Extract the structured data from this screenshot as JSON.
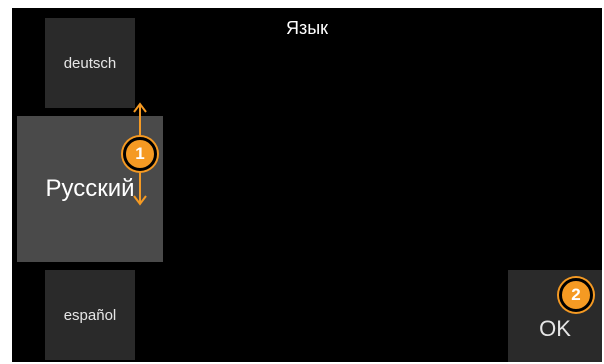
{
  "screen": {
    "title": "Язык"
  },
  "language_list": {
    "previous": "deutsch",
    "selected": "Русский",
    "next": "español"
  },
  "ok_button": {
    "label": "OK"
  },
  "callouts": [
    "1",
    "2"
  ],
  "colors": {
    "background": "#000000",
    "item": "#2a2a2a",
    "selected_item": "#4a4a4a",
    "callout": "#f59a23"
  },
  "icons": {
    "scroll": "up-down-arrow-icon"
  }
}
